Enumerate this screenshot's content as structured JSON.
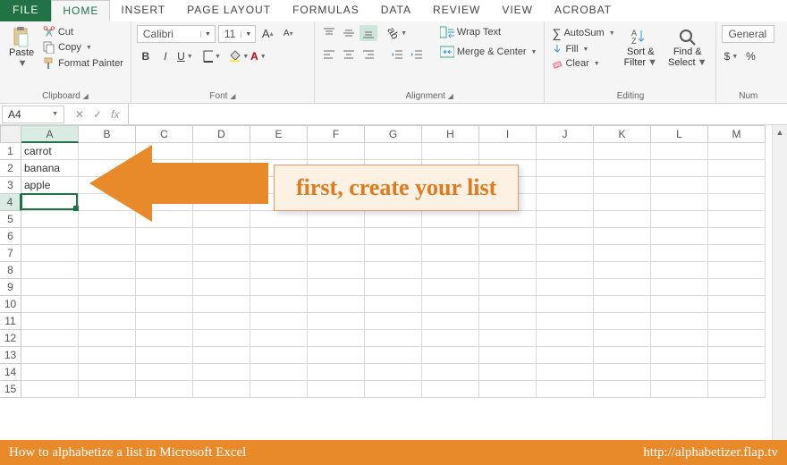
{
  "tabs": {
    "file": "FILE",
    "home": "HOME",
    "insert": "INSERT",
    "pagelayout": "PAGE LAYOUT",
    "formulas": "FORMULAS",
    "data": "DATA",
    "review": "REVIEW",
    "view": "VIEW",
    "acrobat": "ACROBAT"
  },
  "ribbon": {
    "clipboard": {
      "paste": "Paste",
      "cut": "Cut",
      "copy": "Copy",
      "fmtpainter": "Format Painter",
      "label": "Clipboard"
    },
    "font": {
      "name": "Calibri",
      "size": "11",
      "label": "Font",
      "bold": "B",
      "italic": "I",
      "underline": "U",
      "growA": "A",
      "shrinkA": "A"
    },
    "alignment": {
      "wrap": "Wrap Text",
      "merge": "Merge & Center",
      "label": "Alignment"
    },
    "editing": {
      "autosum": "AutoSum",
      "fill": "Fill",
      "clear": "Clear",
      "sort": "Sort &",
      "filter": "Filter",
      "find": "Find &",
      "select": "Select",
      "label": "Editing"
    },
    "number": {
      "format": "General",
      "currency": "$",
      "percent": "%",
      "label": "Num"
    }
  },
  "namebox": "A4",
  "fx": "fx",
  "columns": [
    "A",
    "B",
    "C",
    "D",
    "E",
    "F",
    "G",
    "H",
    "I",
    "J",
    "K",
    "L",
    "M"
  ],
  "row_count": 15,
  "cells": {
    "A1": "carrot",
    "A2": "banana",
    "A3": "apple"
  },
  "active_cell": "A4",
  "callout_text": "first, create your list",
  "footer": {
    "title": "How to alphabetize a list in Microsoft Excel",
    "url": "http://alphabetizer.flap.tv"
  },
  "colors": {
    "accent": "#217346",
    "annotation": "#e88a2a"
  }
}
